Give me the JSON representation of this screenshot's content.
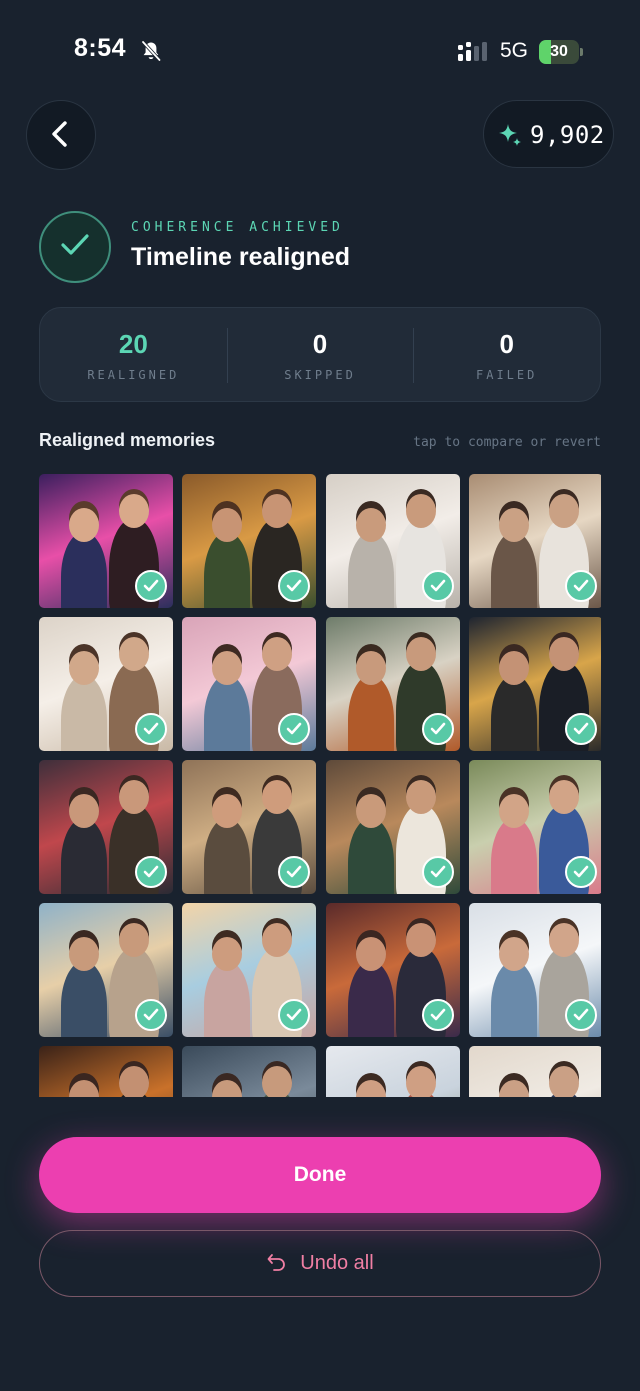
{
  "status_bar": {
    "time": "8:54",
    "network": "5G",
    "battery": "30",
    "battery_level": 0.3,
    "icons": [
      "bell-off-icon",
      "signal-icon",
      "battery-charging-icon"
    ]
  },
  "header": {
    "back_icon": "chevron-left-icon",
    "credits_icon": "sparkle-icon",
    "credits": "9,902"
  },
  "result": {
    "eyebrow": "COHERENCE ACHIEVED",
    "title": "Timeline realigned"
  },
  "stats": [
    {
      "value": "20",
      "label": "REALIGNED",
      "accent": true
    },
    {
      "value": "0",
      "label": "SKIPPED",
      "accent": false
    },
    {
      "value": "0",
      "label": "FAILED",
      "accent": false
    }
  ],
  "memories": {
    "title": "Realigned memories",
    "hint": "tap to compare or revert",
    "count": 20,
    "check_icon": "check-icon"
  },
  "actions": {
    "done": "Done",
    "undo": "Undo all",
    "undo_icon": "undo-arrow-icon"
  },
  "colors": {
    "background": "#19222e",
    "accent_teal": "#5cd6b4",
    "accent_pink": "#ec3fb0",
    "undo_text": "#f07fa4"
  }
}
